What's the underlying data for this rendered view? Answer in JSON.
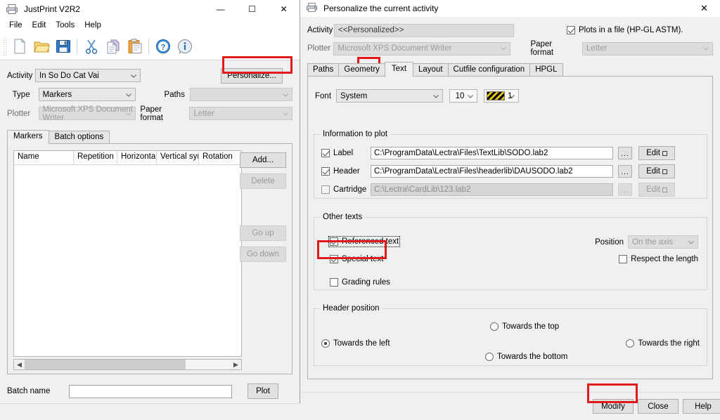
{
  "main_window": {
    "title": "JustPrint V2R2",
    "icon": "printer-icon",
    "controls": {
      "minimize": "—",
      "maximize": "☐",
      "close": "✕"
    },
    "menu": [
      "File",
      "Edit",
      "Tools",
      "Help"
    ],
    "toolbar_icons": [
      "new-document-icon",
      "open-folder-icon",
      "save-icon",
      "cut-icon",
      "copy-icon",
      "paste-icon",
      "help-icon",
      "info-icon"
    ],
    "form": {
      "activity_label": "Activity",
      "activity_value": "In So Do Cat Vai",
      "personalize_button": "Personalize...",
      "type_label": "Type",
      "type_value": "Markers",
      "paths_label": "Paths",
      "paths_value": "",
      "plotter_label": "Plotter",
      "plotter_value": "Microsoft XPS Document Writer",
      "paper_format_label": "Paper format",
      "paper_format_value": "Letter"
    },
    "tabs": [
      {
        "label": "Markers",
        "active": true
      },
      {
        "label": "Batch options",
        "active": false
      }
    ],
    "grid": {
      "columns": [
        "Name",
        "Repetition",
        "Horizontal s...",
        "Vertical sym...",
        "Rotation"
      ],
      "rows": []
    },
    "side_buttons": [
      {
        "label": "Add...",
        "enabled": true
      },
      {
        "label": "Delete",
        "enabled": false
      },
      {
        "label": "Go up",
        "enabled": false
      },
      {
        "label": "Go down",
        "enabled": false
      }
    ],
    "batch_name_label": "Batch name",
    "batch_name_value": "",
    "batch_name_placeholder": "",
    "plot_button": "Plot"
  },
  "dialog": {
    "title": "Personalize the current activity",
    "icon": "printer-icon",
    "close": "✕",
    "activity_label": "Activity",
    "activity_value": "<<Personalized>>",
    "plots_in_file_label": "Plots in a file (HP-GL ASTM).",
    "plots_in_file_checked": true,
    "plotter_label": "Plotter",
    "plotter_value": "Microsoft XPS Document Writer",
    "paper_format_label": "Paper format",
    "paper_format_value": "Letter",
    "tabs": [
      {
        "label": "Paths",
        "active": false
      },
      {
        "label": "Geometry",
        "active": false
      },
      {
        "label": "Text",
        "active": true
      },
      {
        "label": "Layout",
        "active": false
      },
      {
        "label": "Cutfile configuration",
        "active": false
      },
      {
        "label": "HPGL",
        "active": false
      }
    ],
    "font": {
      "label": "Font",
      "family_value": "System",
      "size_value": "10",
      "pen_value": "1"
    },
    "information_to_plot": {
      "title": "Information to plot",
      "rows": [
        {
          "label": "Label",
          "checked": true,
          "enabled": true,
          "path": "C:\\ProgramData\\Lectra\\Files\\TextLib\\SODO.lab2",
          "browse": "...",
          "edit": "Edit"
        },
        {
          "label": "Header",
          "checked": true,
          "enabled": true,
          "path": "C:\\ProgramData\\Lectra\\Files\\headerlib\\DAUSODO.lab2",
          "browse": "...",
          "edit": "Edit"
        },
        {
          "label": "Cartridge",
          "checked": false,
          "enabled": false,
          "path": "C:\\Lectra\\CardLib\\123.lab2",
          "browse": "...",
          "edit": "Edit"
        }
      ]
    },
    "other_texts": {
      "title": "Other texts",
      "referenced_text_label": "Referenced text",
      "referenced_text_checked": true,
      "special_text_label": "Special text",
      "special_text_checked": true,
      "grading_rules_label": "Grading rules",
      "grading_rules_checked": false,
      "position_label": "Position",
      "position_value": "On the axis",
      "respect_length_label": "Respect the length",
      "respect_length_checked": false
    },
    "header_position": {
      "title": "Header position",
      "options": [
        {
          "label": "Towards the top",
          "selected": false
        },
        {
          "label": "Towards the left",
          "selected": true
        },
        {
          "label": "Towards the right",
          "selected": false
        },
        {
          "label": "Towards the bottom",
          "selected": false
        }
      ]
    },
    "footer": {
      "modify": "Modify",
      "close": "Close",
      "help": "Help"
    }
  },
  "highlights": {
    "color": "#e01b1b",
    "targets": [
      "personalize-button",
      "text-tab",
      "referenced-text-checkbox",
      "modify-button"
    ]
  }
}
